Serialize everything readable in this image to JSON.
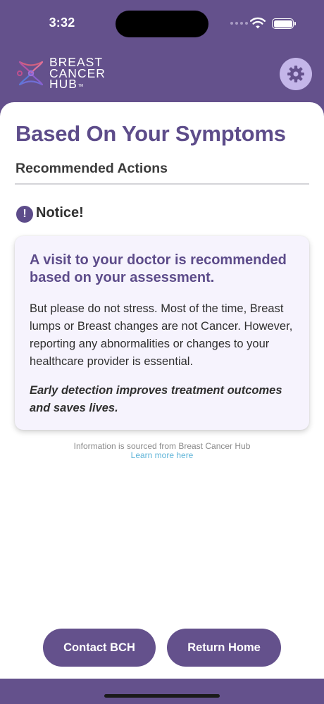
{
  "status_bar": {
    "time": "3:32"
  },
  "header": {
    "logo_lines": [
      "BREAST",
      "CANCER",
      "HUB"
    ],
    "logo_tm": "TM",
    "settings_icon": "gear-icon"
  },
  "page": {
    "title": "Based On Your Symptoms",
    "section_title": "Recommended Actions",
    "notice_icon_glyph": "!",
    "notice_title": "Notice!"
  },
  "info_box": {
    "heading": "A visit to your doctor is recommended based on your assessment.",
    "body": "But please do not stress. Most of the time, Breast lumps or Breast changes are not Cancer. However, reporting any abnormalities or changes to your healthcare provider is essential.",
    "emphasis": "Early detection improves treatment outcomes and saves lives."
  },
  "source": {
    "text": "Information is sourced from Breast Cancer Hub",
    "link_label": "Learn more here"
  },
  "actions": {
    "contact_label": "Contact BCH",
    "return_label": "Return Home"
  },
  "colors": {
    "brand_purple": "#64518c",
    "title_purple": "#5d4c8a",
    "settings_bg": "#c4b6e9",
    "link_blue": "#5fb4d8"
  }
}
